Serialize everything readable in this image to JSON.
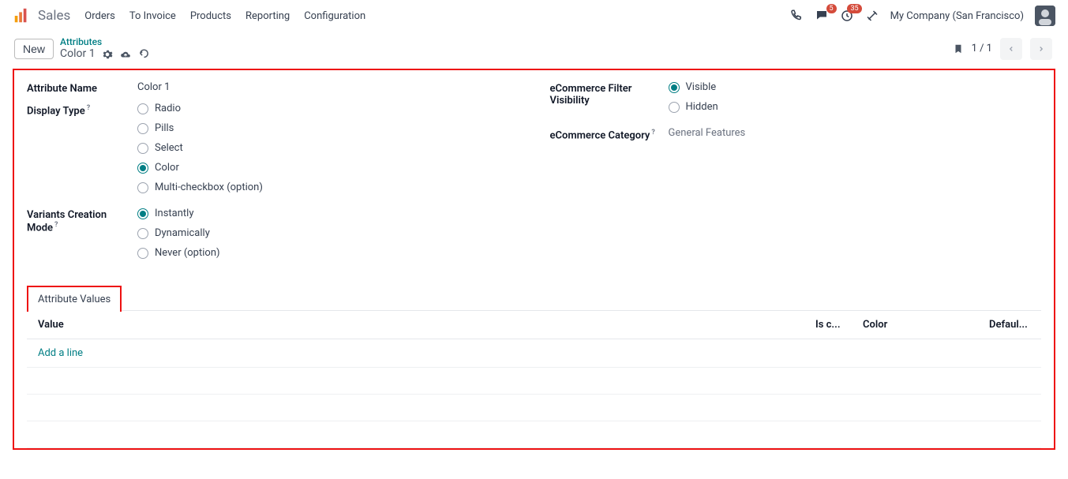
{
  "topbar": {
    "app_name": "Sales",
    "nav": [
      "Orders",
      "To Invoice",
      "Products",
      "Reporting",
      "Configuration"
    ],
    "msg_badge": "5",
    "act_badge": "35",
    "company": "My Company (San Francisco)"
  },
  "subbar": {
    "new_label": "New",
    "breadcrumb_parent": "Attributes",
    "breadcrumb_title": "Color 1",
    "pager": "1 / 1"
  },
  "form": {
    "attr_name_label": "Attribute Name",
    "attr_name_value": "Color 1",
    "display_type_label": "Display Type",
    "display_type_options": {
      "radio": "Radio",
      "pills": "Pills",
      "select": "Select",
      "color": "Color",
      "multi": "Multi-checkbox (option)"
    },
    "variants_label": "Variants Creation Mode",
    "variants_options": {
      "instantly": "Instantly",
      "dynamically": "Dynamically",
      "never": "Never (option)"
    },
    "ecom_filter_label": "eCommerce Filter Visibility",
    "ecom_filter_options": {
      "visible": "Visible",
      "hidden": "Hidden"
    },
    "ecom_cat_label": "eCommerce Category",
    "ecom_cat_value": "General Features"
  },
  "tab": {
    "label": "Attribute Values"
  },
  "table": {
    "col_value": "Value",
    "col_isc": "Is c...",
    "col_color": "Color",
    "col_def": "Defaul...",
    "add_line": "Add a line"
  }
}
